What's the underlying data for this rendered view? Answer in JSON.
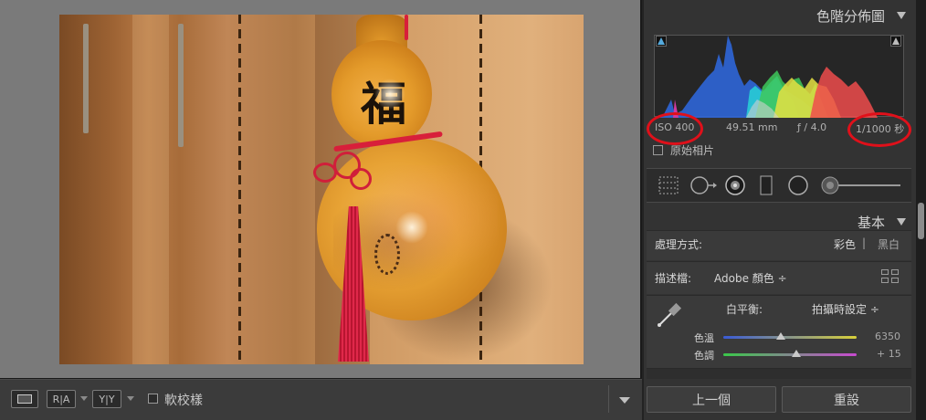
{
  "right_panel": {
    "histogram_title": "色階分佈圖",
    "exif": {
      "iso": "ISO 400",
      "focal_length": "49.51 mm",
      "aperture": "ƒ / 4.0",
      "shutter": "1/1000 秒"
    },
    "original_photo_label": "原始相片",
    "basic_title": "基本",
    "treatment": {
      "label": "處理方式:",
      "color": "彩色",
      "separator": "|",
      "bw": "黑白"
    },
    "profile": {
      "label": "描述檔:",
      "value": "Adobe 顏色 ÷"
    },
    "white_balance": {
      "label": "白平衡:",
      "value": "拍攝時設定 ÷"
    },
    "temp": {
      "label": "色溫",
      "value": "6350",
      "fraction": 0.43
    },
    "tint": {
      "label": "色調",
      "value": "+ 15",
      "fraction": 0.55
    }
  },
  "toolbar": {
    "soft_proof_label": "軟校樣",
    "ra_label": "R|A",
    "yy_label": "Y|Y"
  },
  "buttons": {
    "previous": "上一個",
    "reset": "重設"
  },
  "colors": {
    "annotation_ring": "#e0101a",
    "panel_bg": "#333333",
    "accent_red": "#d81f3a"
  },
  "icons": [
    "crop-overlay-icon",
    "spot-removal-icon",
    "red-eye-icon",
    "graduated-filter-icon",
    "radial-filter-icon",
    "adjustment-brush-icon",
    "eyedropper-icon",
    "grid-icon",
    "loupe-view-icon"
  ]
}
